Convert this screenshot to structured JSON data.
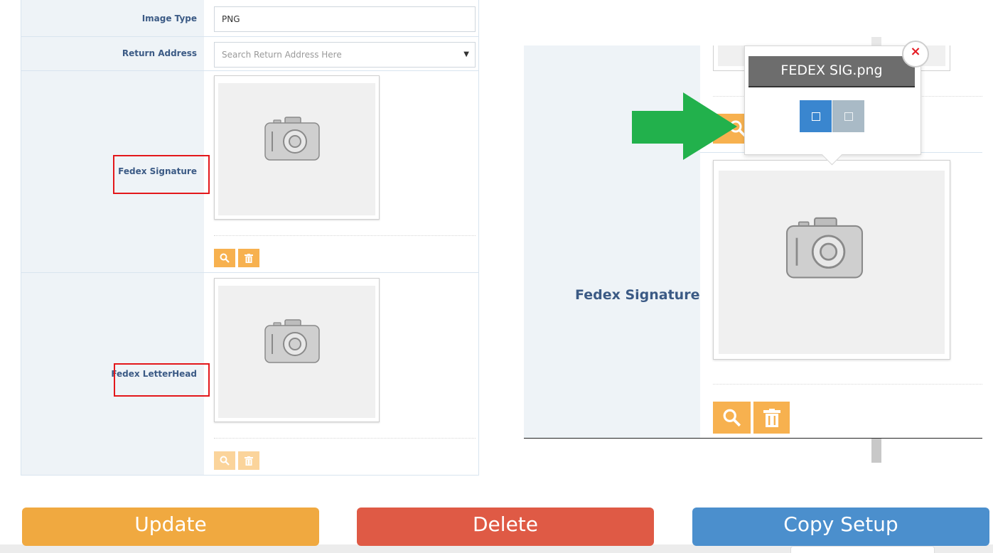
{
  "form": {
    "image_type": {
      "label": "Image Type",
      "value": "PNG"
    },
    "return_address": {
      "label": "Return Address",
      "placeholder": "Search Return Address Here"
    },
    "fedex_signature": {
      "label": "Fedex Signature"
    },
    "fedex_letterhead": {
      "label": "Fedex LetterHead"
    }
  },
  "zoom": {
    "label": "Fedex Signature",
    "popover": {
      "title": "FEDEX SIG.png",
      "close_glyph": "×"
    }
  },
  "actions": {
    "update": "Update",
    "delete": "Delete",
    "copy_setup": "Copy Setup"
  },
  "colors": {
    "orange": "#f0a940",
    "red": "#df5a45",
    "blue": "#4b8fcd",
    "label_blue": "#3b5a85",
    "highlight_red": "#e3171b",
    "arrow_green": "#22b14c"
  }
}
